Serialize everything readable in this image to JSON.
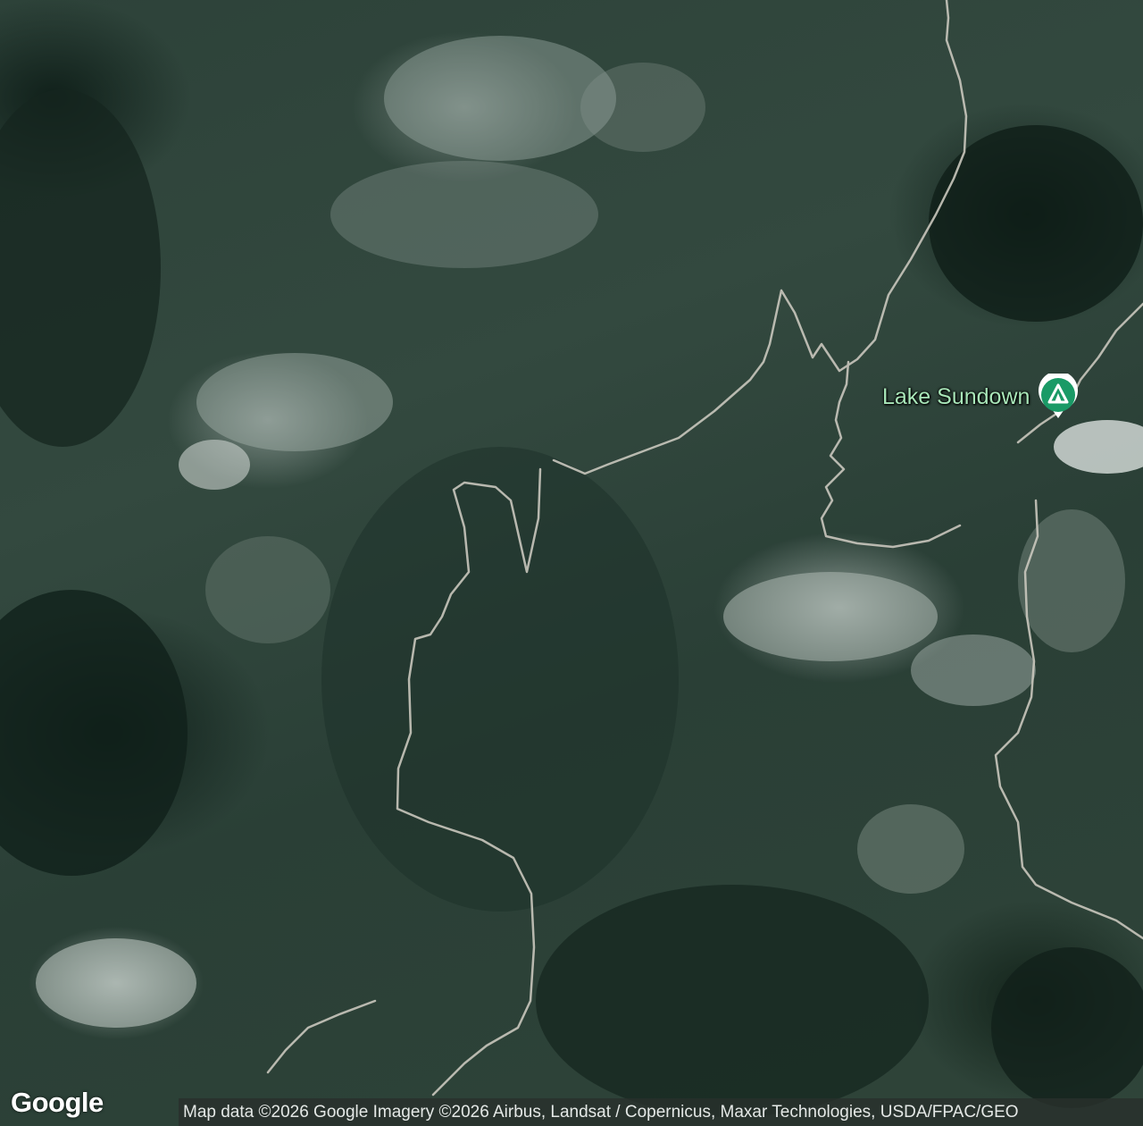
{
  "map": {
    "imagery": "satellite"
  },
  "place_marker": {
    "label": "Lake Sundown",
    "icon": "campground-icon",
    "pin_color": "#1a9a66"
  },
  "branding": {
    "logo_text": "Google"
  },
  "attribution": {
    "text": "Map data ©2026 Google Imagery ©2026 Airbus, Landsat / Copernicus, Maxar Technologies, USDA/FPAC/GEO"
  },
  "colors": {
    "road": "#c9c6bd",
    "marker_label": "#a8e6b8"
  }
}
